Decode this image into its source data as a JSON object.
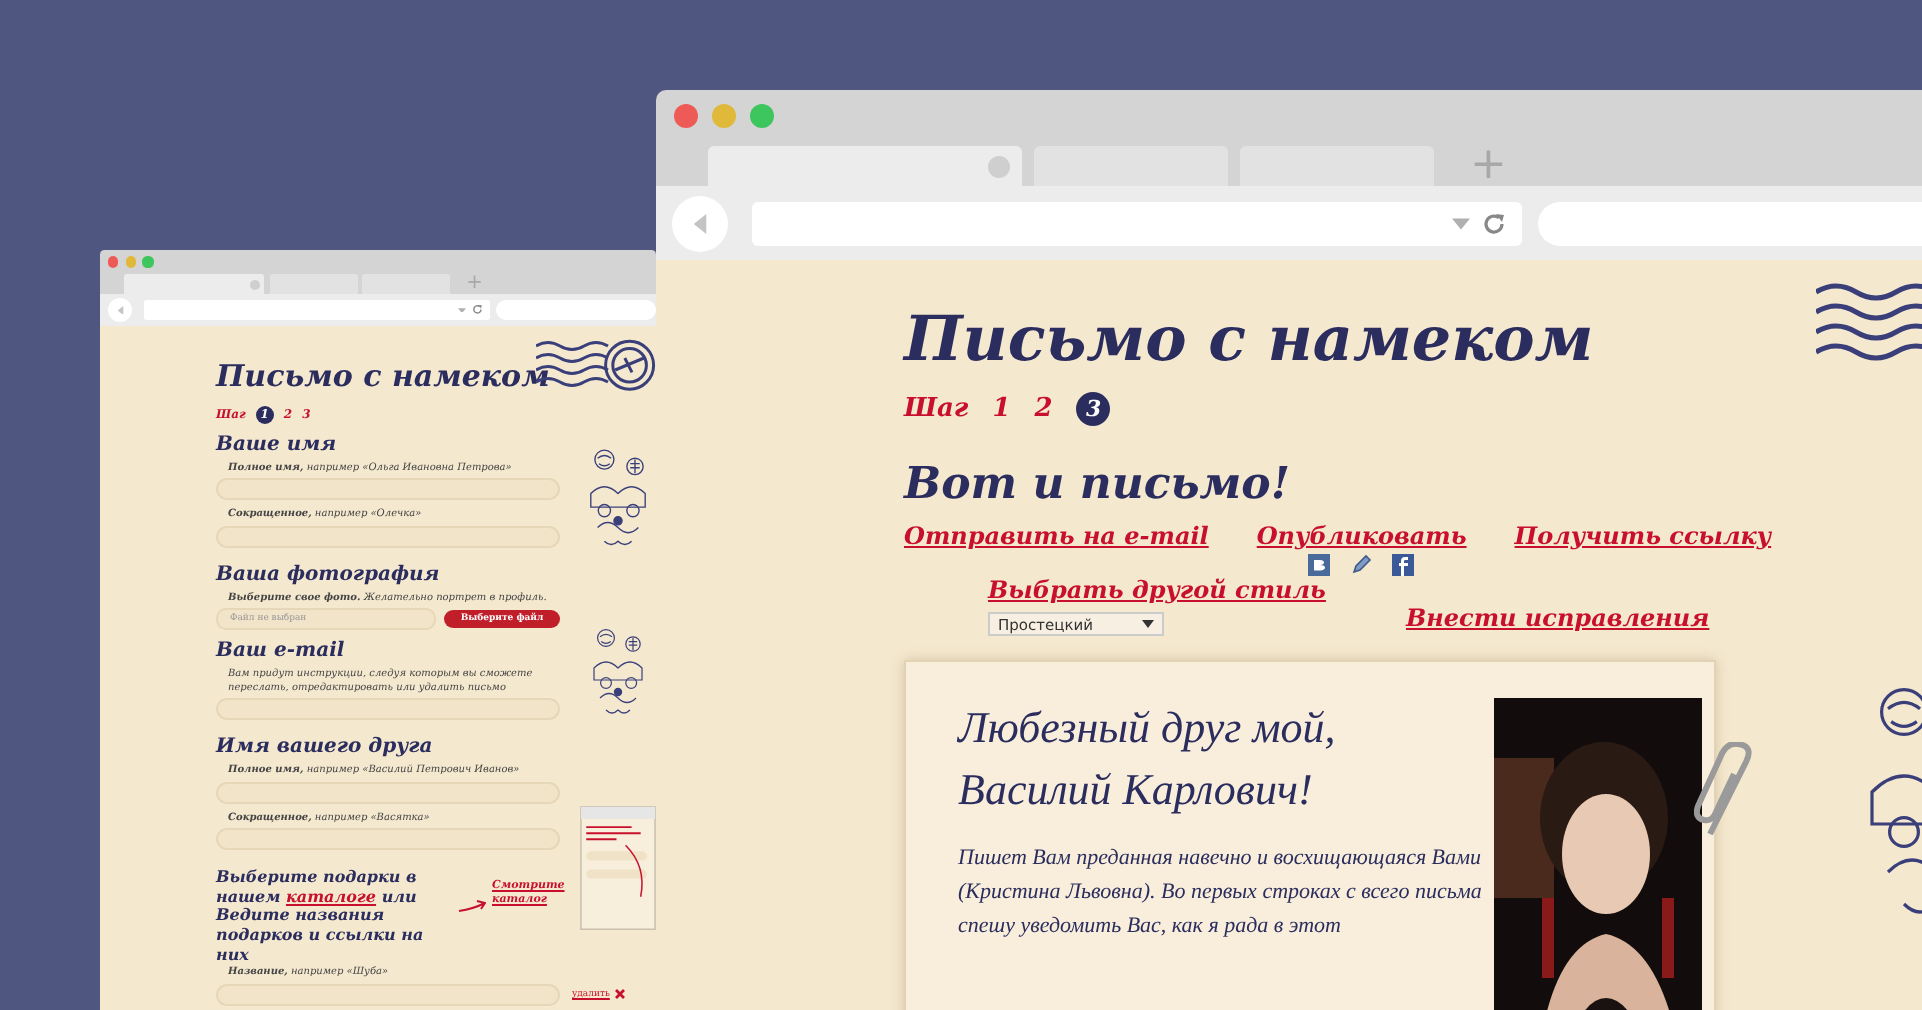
{
  "back_window": {
    "tabs": [
      {
        "selected": true
      },
      {
        "selected": false
      },
      {
        "selected": false
      }
    ],
    "new_tab": "+",
    "page": {
      "title": "Письмо с намеком",
      "steps": {
        "label": "Шаг",
        "items": [
          {
            "label": "1",
            "selected": true
          },
          {
            "label": "2",
            "selected": false
          },
          {
            "label": "3",
            "selected": false
          }
        ]
      },
      "sections": [
        {
          "heading": "Ваше имя",
          "fields": [
            {
              "kind": "text",
              "hint": "**Полное имя,** например «Ольга Ивановна Петрова»"
            },
            {
              "kind": "text",
              "hint": "**Сокращенное,** например «Олечка»"
            }
          ]
        },
        {
          "heading": "Ваша фотография",
          "fields": [
            {
              "kind": "file",
              "hint": "**Выберите свое фото.** Желательно портрет в профиль.",
              "status": "Файл не выбран",
              "button": "Выберите файл"
            }
          ]
        },
        {
          "heading": "Ваш e-mail",
          "fields": [
            {
              "kind": "text",
              "hint": "Вам придут инструкции, следуя которым вы сможете переслать, отредактировать или удалить письмо"
            }
          ]
        },
        {
          "heading": "Имя вашего друга",
          "fields": [
            {
              "kind": "text",
              "hint": "**Полное имя,** например «Василий Петрович Иванов»"
            },
            {
              "kind": "text",
              "hint": "**Сокращенное,** например «Васятка»"
            }
          ]
        }
      ],
      "gifts": {
        "text_before": "Выберите подарки в нашем",
        "link": "каталоге",
        "text_after": "или Ведите названия подарков и ссылки на них",
        "catalog_note": "Смотрите каталог",
        "fields": [
          {
            "kind": "text",
            "hint": "**Название,** например «Шуба»"
          }
        ],
        "remove": "удалить"
      }
    }
  },
  "front_window": {
    "tabs": [
      {
        "selected": true
      },
      {
        "selected": false
      },
      {
        "selected": false
      }
    ],
    "new_tab": "+",
    "page": {
      "title": "Письмо с намеком",
      "steps": {
        "label": "Шаг",
        "items": [
          {
            "label": "1",
            "selected": false
          },
          {
            "label": "2",
            "selected": false
          },
          {
            "label": "3",
            "selected": true
          }
        ]
      },
      "heading": "Вот и письмо!",
      "actions": [
        {
          "kind": "link",
          "label": "Отправить на e-mail"
        },
        {
          "kind": "share",
          "label": "Опубликовать"
        },
        {
          "kind": "link",
          "label": "Получить ссылку"
        }
      ],
      "style": {
        "label": "Выбрать другой стиль",
        "value": "Простецкий"
      },
      "edit": "Внести исправления",
      "letter": {
        "greeting": [
          "Любезный друг мой,",
          "Василий Карлович!"
        ],
        "body": "Пишет Вам преданная навечно и восхищающаяся Вами (Кристина Львовна). Во первых строках с всего письма спешу уведомить Вас, как я рада в этот",
        "photo": {
          "kind": "picture"
        }
      }
    }
  }
}
